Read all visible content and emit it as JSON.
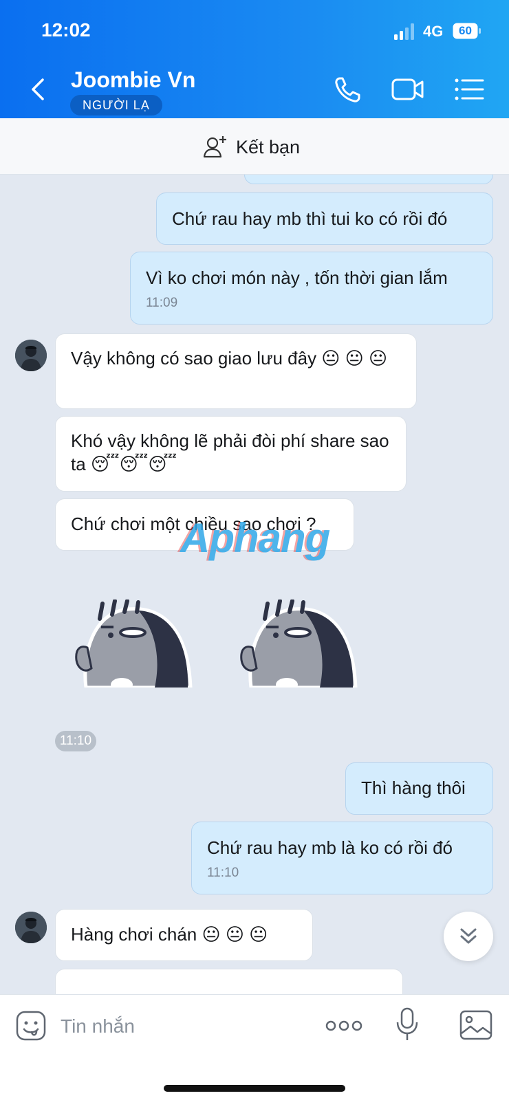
{
  "status_bar": {
    "time": "12:02",
    "network": "4G",
    "battery": "60"
  },
  "header": {
    "contact_name": "Joombie Vn",
    "badge": "NGƯỜI LẠ",
    "icons": [
      "back-icon",
      "phone-icon",
      "video-call-icon",
      "menu-icon"
    ]
  },
  "friend_bar": {
    "label": "Kết bạn",
    "icon": "add-friend-icon"
  },
  "messages": [
    {
      "side": "sent",
      "text": "Chứ rau hay mb thì tui ko có rồi đó"
    },
    {
      "side": "sent",
      "text": "Vì ko chơi món này , tốn thời gian lắm",
      "time": "11:09"
    },
    {
      "side": "received",
      "text": "Vậy không có sao giao lưu đây 😐 😐 😐"
    },
    {
      "side": "received",
      "text": "Khó vậy không lẽ phải đòi phí share sao ta 😴😴😴"
    },
    {
      "side": "received",
      "text": "Chứ chơi một chiều sao chơi ?"
    },
    {
      "side": "received",
      "type": "sticker",
      "count": 2
    },
    {
      "side": "sent",
      "text": "Thì hàng thôi"
    },
    {
      "side": "sent",
      "text": "Chứ rau hay mb là ko có rồi đó",
      "time": "11:10"
    },
    {
      "side": "received",
      "text": "Hàng chơi chán 😐 😐 😐"
    }
  ],
  "timestamps": {
    "sticker_time": "11:10"
  },
  "watermark": "Aphang",
  "input": {
    "placeholder": "Tin nhắn"
  },
  "colors": {
    "header_start": "#0a6ff0",
    "header_end": "#20a6f3",
    "sent_bubble": "#d4ecfd",
    "received_bubble": "#ffffff",
    "chat_bg": "#e2e8f1"
  }
}
